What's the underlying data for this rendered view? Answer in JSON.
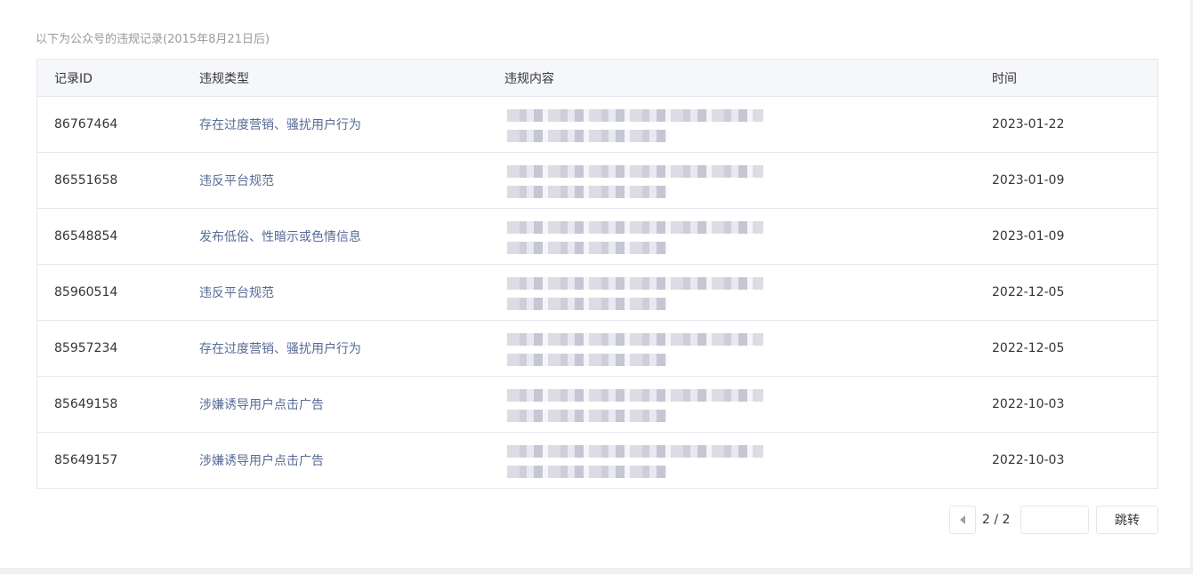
{
  "intro_text": "以下为公众号的违规记录(2015年8月21日后)",
  "table": {
    "headers": {
      "id": "记录ID",
      "type": "违规类型",
      "content": "违规内容",
      "time": "时间"
    },
    "rows": [
      {
        "id": "86767464",
        "type": "存在过度营销、骚扰用户行为",
        "time": "2023-01-22"
      },
      {
        "id": "86551658",
        "type": "违反平台规范",
        "time": "2023-01-09"
      },
      {
        "id": "86548854",
        "type": "发布低俗、性暗示或色情信息",
        "time": "2023-01-09"
      },
      {
        "id": "85960514",
        "type": "违反平台规范",
        "time": "2022-12-05"
      },
      {
        "id": "85957234",
        "type": "存在过度营销、骚扰用户行为",
        "time": "2022-12-05"
      },
      {
        "id": "85649158",
        "type": "涉嫌诱导用户点击广告",
        "time": "2022-10-03"
      },
      {
        "id": "85649157",
        "type": "涉嫌诱导用户点击广告",
        "time": "2022-10-03"
      }
    ]
  },
  "pagination": {
    "indicator": "2 / 2",
    "jump_input_value": "",
    "jump_label": "跳转"
  },
  "colors": {
    "type_link": "#576b95",
    "header_bg": "#f6f7fa",
    "border": "#e7e7eb"
  },
  "icons": {
    "prev": "triangle-left-icon"
  }
}
